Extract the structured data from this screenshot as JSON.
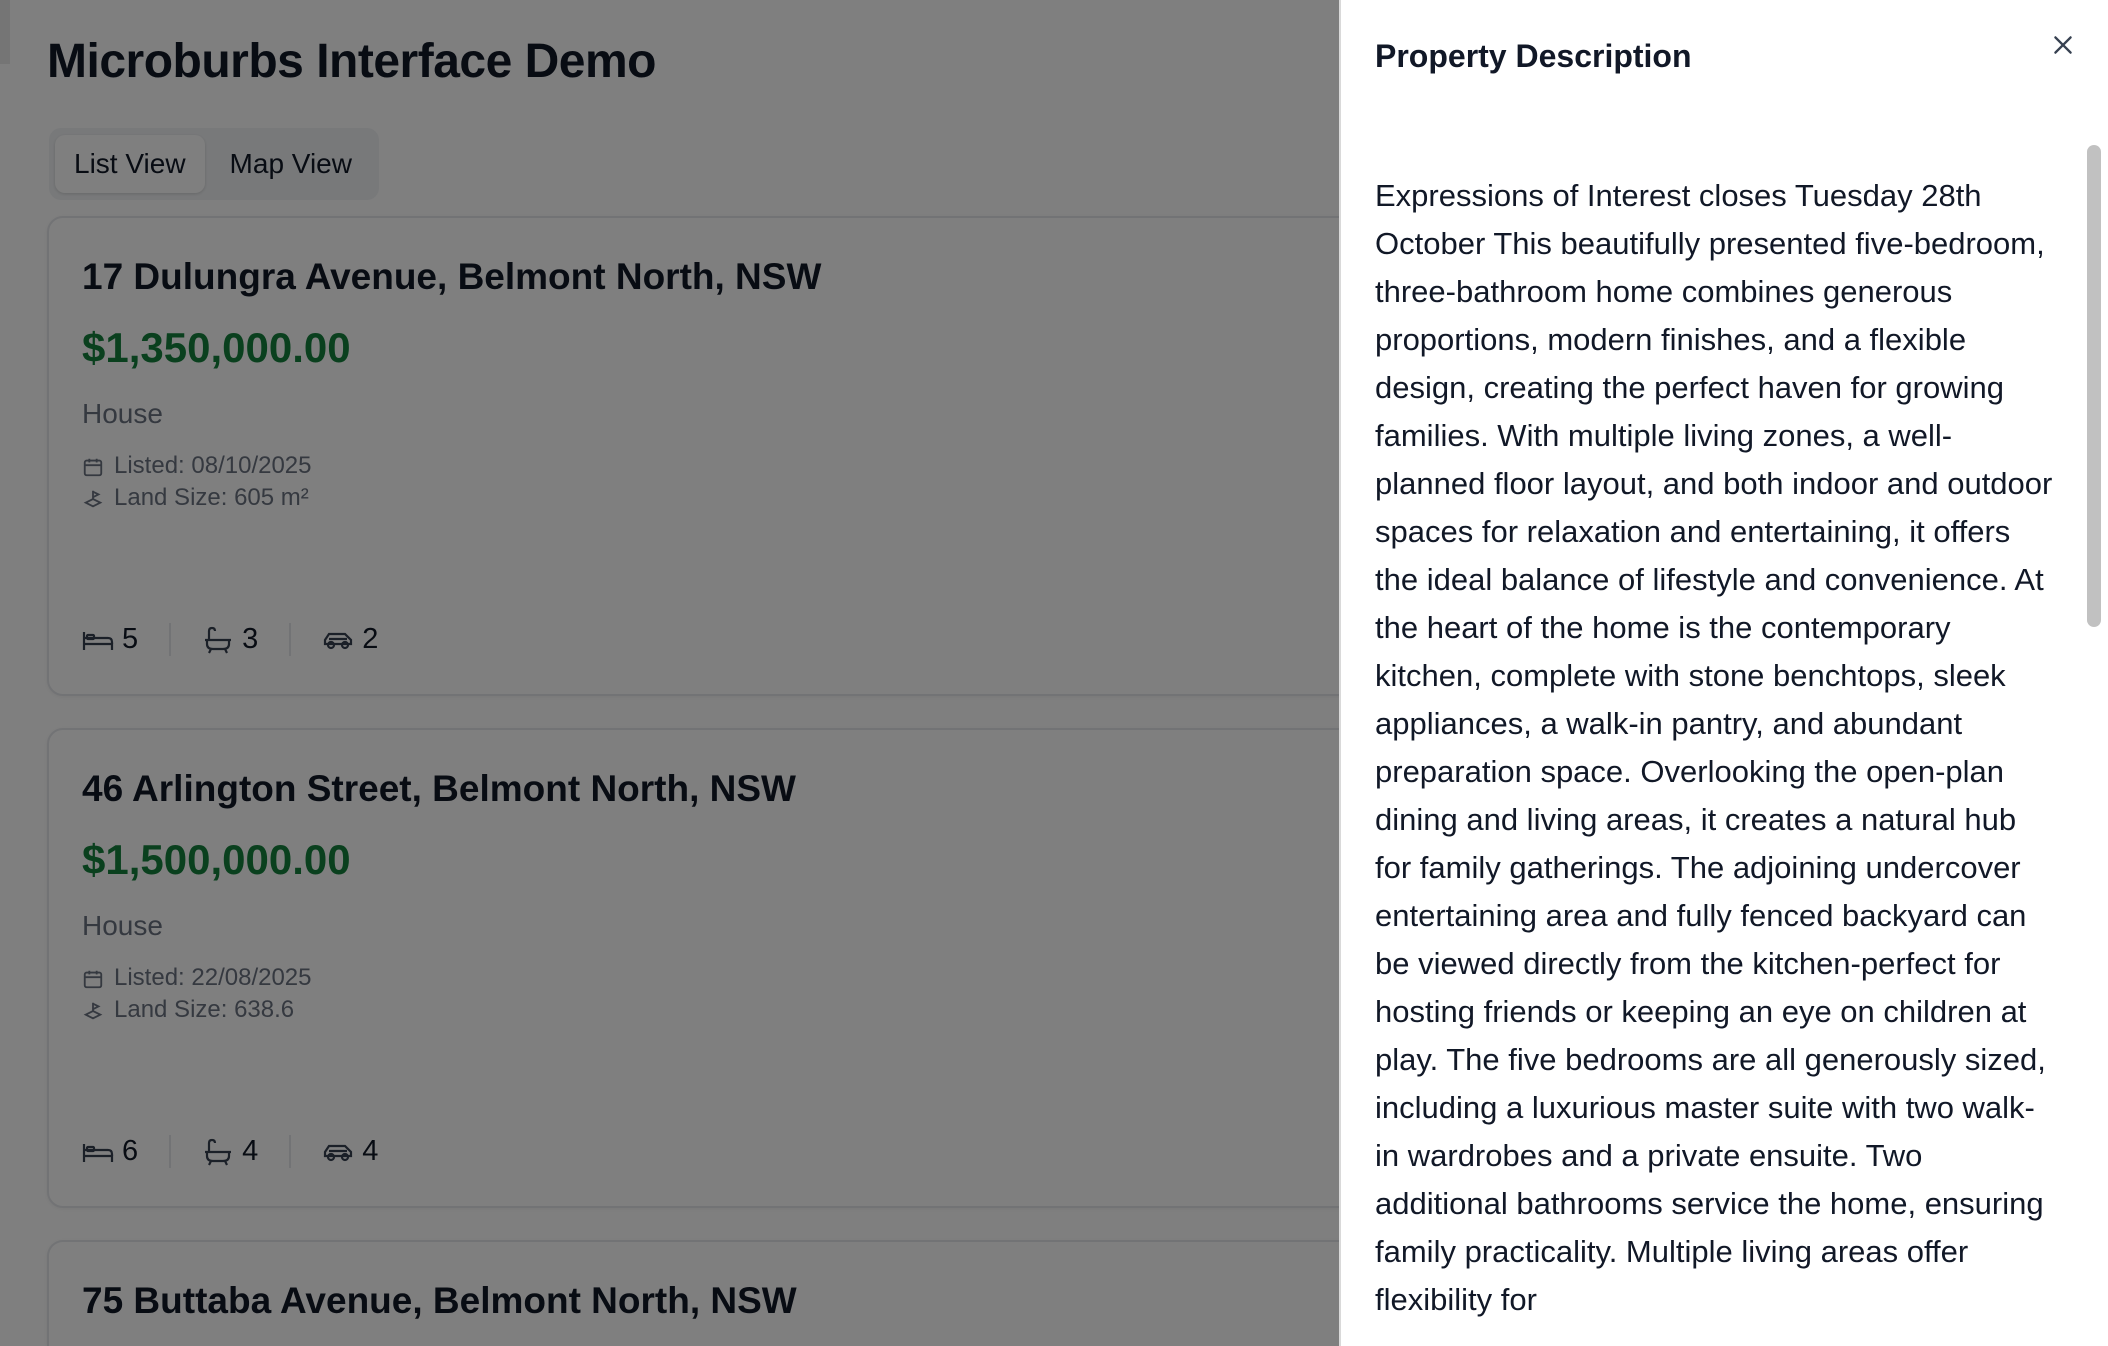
{
  "page": {
    "title": "Microburbs Interface Demo",
    "tabs": [
      {
        "label": "List View",
        "active": true
      },
      {
        "label": "Map View",
        "active": false
      }
    ]
  },
  "listings": [
    {
      "address": "17 Dulungra Avenue, Belmont North, NSW",
      "price": "$1,350,000.00",
      "type": "House",
      "listed": "Listed: 08/10/2025",
      "land_size": "Land Size: 605 m²",
      "beds": "5",
      "baths": "3",
      "cars": "2"
    },
    {
      "address": "46 Arlington Street, Belmont North, NSW",
      "price": "$1,500,000.00",
      "type": "House",
      "listed": "Listed: 22/08/2025",
      "land_size": "Land Size: 638.6",
      "beds": "6",
      "baths": "4",
      "cars": "4"
    },
    {
      "address": "75 Buttaba Avenue, Belmont North, NSW"
    }
  ],
  "drawer": {
    "title": "Property Description",
    "description": "Expressions of Interest closes Tuesday 28th October This beautifully presented five-bedroom, three-bathroom home combines generous proportions, modern finishes, and a flexible design, creating the perfect haven for growing families. With multiple living zones, a well-planned floor layout, and both indoor and outdoor spaces for relaxation and entertaining, it offers the ideal balance of lifestyle and convenience. At the heart of the home is the contemporary kitchen, complete with stone benchtops, sleek appliances, a walk-in pantry, and abundant preparation space. Overlooking the open-plan dining and living areas, it creates a natural hub for family gatherings. The adjoining undercover entertaining area and fully fenced backyard can be viewed directly from the kitchen-perfect for hosting friends or keeping an eye on children at play. The five bedrooms are all generously sized, including a luxurious master suite with two walk-in wardrobes and a private ensuite. Two additional bathrooms service the home, ensuring family practicality. Multiple living areas offer flexibility for"
  },
  "colors": {
    "price": "#15803d",
    "overlay": "rgba(0,0,0,0.5)",
    "text": "#111827",
    "muted": "#6b7280"
  },
  "icons": [
    "calendar-icon",
    "land-size-icon",
    "bed-icon",
    "bath-icon",
    "car-icon",
    "close-icon"
  ]
}
